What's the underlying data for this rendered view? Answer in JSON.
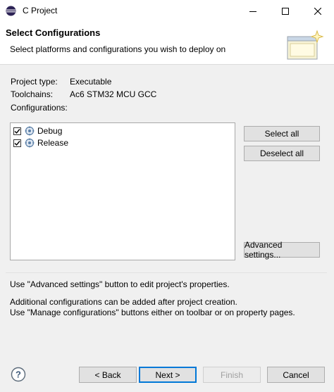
{
  "window": {
    "title": "C Project"
  },
  "header": {
    "title": "Select Configurations",
    "description": "Select platforms and configurations you wish to deploy on"
  },
  "project": {
    "type_label": "Project type:",
    "type_value": "Executable",
    "toolchains_label": "Toolchains:",
    "toolchains_value": "Ac6 STM32 MCU GCC",
    "configurations_label": "Configurations:"
  },
  "configurations": [
    {
      "label": "Debug",
      "checked": true
    },
    {
      "label": "Release",
      "checked": true
    }
  ],
  "side_buttons": {
    "select_all": "Select all",
    "deselect_all": "Deselect all",
    "advanced_settings": "Advanced settings..."
  },
  "info": {
    "line1": "Use \"Advanced settings\" button to edit project's properties.",
    "line2": "Additional configurations can be added after project creation.",
    "line3": "Use \"Manage configurations\" buttons either on toolbar or on property pages."
  },
  "footer": {
    "back": "< Back",
    "next": "Next >",
    "finish": "Finish",
    "cancel": "Cancel"
  },
  "colors": {
    "accent": "#0078d7",
    "window_bg": "#f0f0f0"
  }
}
